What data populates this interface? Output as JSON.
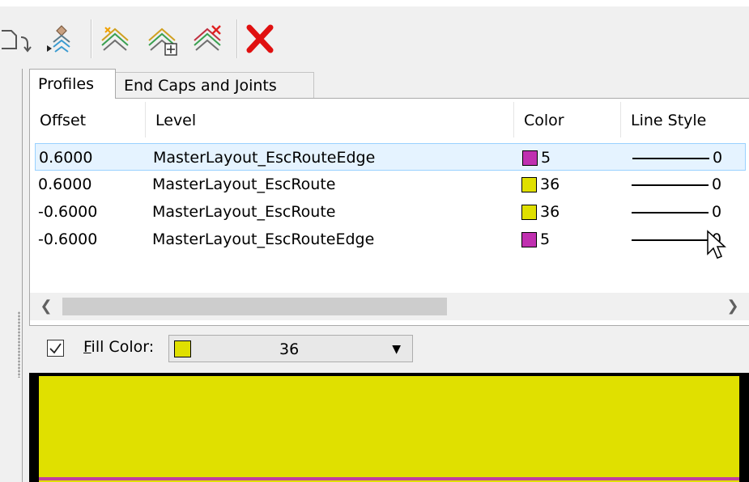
{
  "tabs": [
    {
      "label": "Profiles",
      "active": true
    },
    {
      "label": "End Caps and Joints",
      "active": false
    }
  ],
  "table": {
    "columns": [
      "Offset",
      "Level",
      "Color",
      "Line Style"
    ],
    "rows": [
      {
        "offset": "0.6000",
        "level": "MasterLayout_EscRouteEdge",
        "color_value": "5",
        "color_hex": "#c030b0",
        "line_style": "0",
        "selected": true
      },
      {
        "offset": "0.6000",
        "level": "MasterLayout_EscRoute",
        "color_value": "36",
        "color_hex": "#e0e000",
        "line_style": "0",
        "selected": false
      },
      {
        "offset": "-0.6000",
        "level": "MasterLayout_EscRoute",
        "color_value": "36",
        "color_hex": "#e0e000",
        "line_style": "0",
        "selected": false
      },
      {
        "offset": "-0.6000",
        "level": "MasterLayout_EscRouteEdge",
        "color_value": "5",
        "color_hex": "#c030b0",
        "line_style": "0",
        "selected": false
      }
    ]
  },
  "fill": {
    "checked": true,
    "label_prefix": "F",
    "label_rest": "ill Color:",
    "value": "36",
    "color_hex": "#e0e000"
  },
  "colors": {
    "fill_yellow": "#e0e000",
    "edge_magenta": "#c030b0",
    "delete_red": "#e01010",
    "selection": "#e5f3ff"
  },
  "icons": [
    "rotate-icon",
    "move-up-profile-icon",
    "add-profile-icon",
    "insert-profile-icon",
    "remove-profile-icon",
    "delete-icon"
  ]
}
